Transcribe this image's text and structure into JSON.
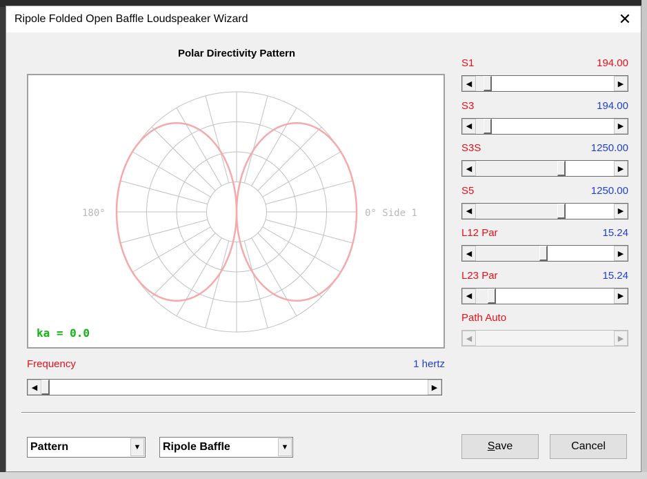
{
  "window": {
    "title": "Ripole Folded Open Baffle Loudspeaker Wizard",
    "close_glyph": "✕"
  },
  "plot": {
    "title": "Polar Directivity Pattern",
    "label_180": "180°",
    "label_0": "0° Side 1",
    "ka_label": "ka = 0.0",
    "pattern_color": "#f4aaaa",
    "grid_color": "#c0c0c0"
  },
  "frequency": {
    "label": "Frequency",
    "value": "1 hertz",
    "slider_position": 0.0
  },
  "params": [
    {
      "name": "S1",
      "value": "194.00",
      "name_color": "#e8101a",
      "value_color": "#e8101a",
      "slider_position": 0.06,
      "disabled": false
    },
    {
      "name": "S3",
      "value": "194.00",
      "name_color": "#e8101a",
      "value_color": "#2040d0",
      "slider_position": 0.06,
      "disabled": false
    },
    {
      "name": "S3S",
      "value": "1250.00",
      "name_color": "#e8101a",
      "value_color": "#2040d0",
      "slider_position": 0.63,
      "disabled": false
    },
    {
      "name": "S5",
      "value": "1250.00",
      "name_color": "#e8101a",
      "value_color": "#2040d0",
      "slider_position": 0.63,
      "disabled": false
    },
    {
      "name": "L12 Par",
      "value": "15.24",
      "name_color": "#e8101a",
      "value_color": "#2040d0",
      "slider_position": 0.49,
      "disabled": false
    },
    {
      "name": "L23 Par",
      "value": "15.24",
      "name_color": "#e8101a",
      "value_color": "#2040d0",
      "slider_position": 0.09,
      "disabled": false
    },
    {
      "name": "Path Auto",
      "value": "",
      "name_color": "#e8101a",
      "value_color": "#2040d0",
      "slider_position": 0.0,
      "disabled": true
    }
  ],
  "combos": {
    "view": "Pattern",
    "model": "Ripole Baffle"
  },
  "buttons": {
    "save_mnemonic": "S",
    "save_rest": "ave",
    "cancel": "Cancel"
  }
}
